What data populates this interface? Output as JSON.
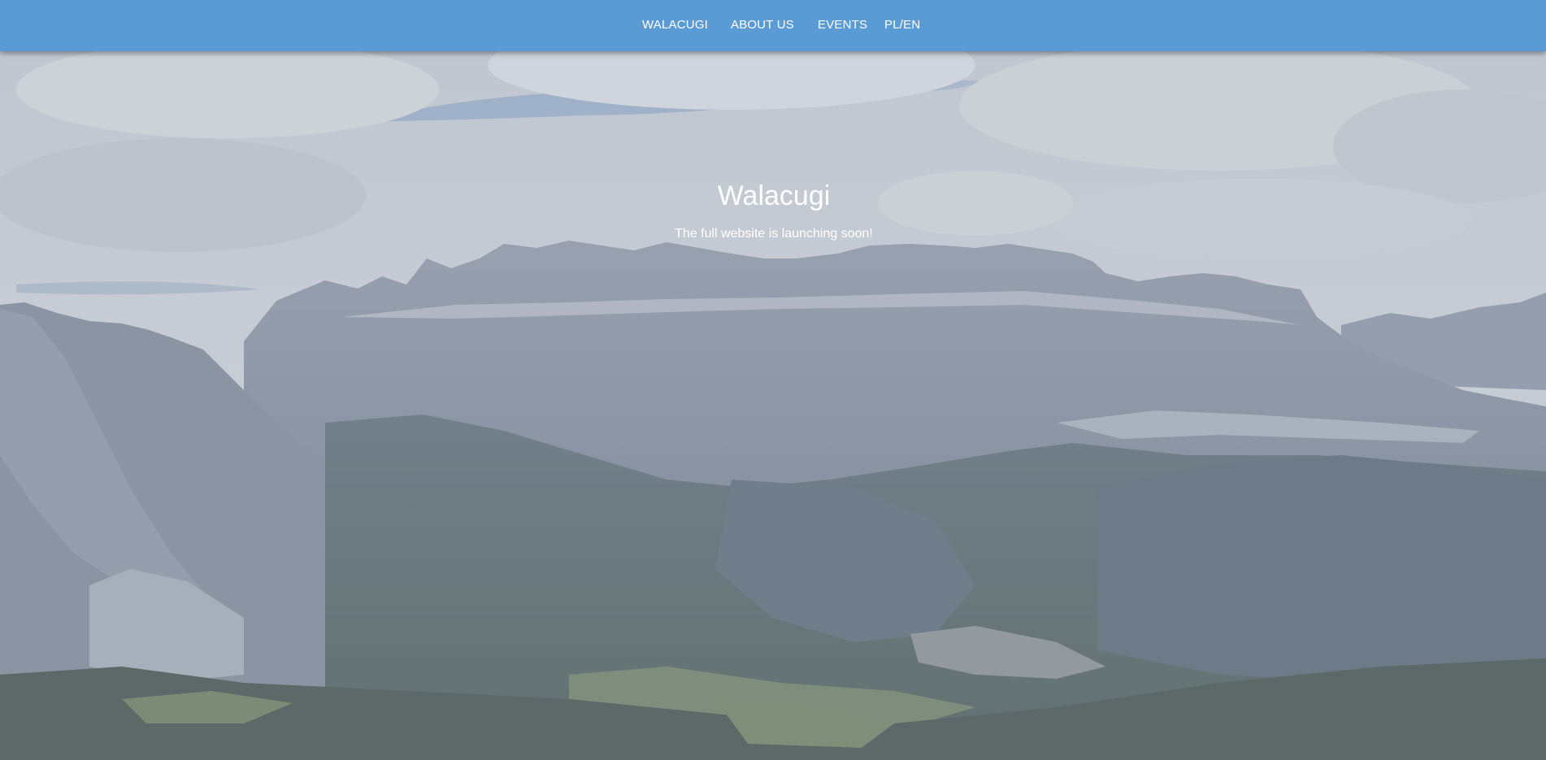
{
  "nav": {
    "items": [
      {
        "label": "WALACUGI"
      },
      {
        "label": "ABOUT US"
      },
      {
        "label": "EVENTS"
      },
      {
        "label": "PL/EN"
      }
    ]
  },
  "hero": {
    "title": "Walacugi",
    "subtitle": "The full website is launching soon!"
  },
  "colors": {
    "navbar": "#5b9bd5",
    "text": "#ffffff"
  }
}
